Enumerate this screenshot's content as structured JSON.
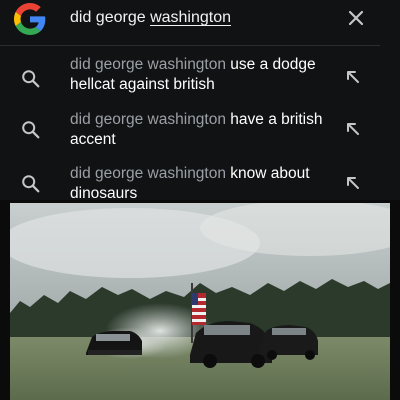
{
  "search": {
    "query_prefix": "did george ",
    "query_underlined": "washington",
    "logo_icon": "google-g-logo",
    "clear_icon": "close-icon"
  },
  "suggestions": [
    {
      "prefix": "did george washington ",
      "completion": "use a dodge hellcat against british",
      "icon": "search-icon",
      "action_icon": "arrow-up-left-icon"
    },
    {
      "prefix": "did george washington ",
      "completion": "have a british accent",
      "icon": "search-icon",
      "action_icon": "arrow-up-left-icon"
    },
    {
      "prefix": "did george washington ",
      "completion": "know about dinosaurs",
      "icon": "search-icon",
      "action_icon": "arrow-up-left-icon"
    }
  ],
  "colors": {
    "panel_bg": "#111213",
    "text_primary": "#ffffff",
    "text_secondary": "#9aa0a6",
    "google_blue": "#4285F4",
    "google_red": "#EA4335",
    "google_yellow": "#FBBC05",
    "google_green": "#34A853"
  },
  "video": {
    "description_icon": "video-still-image"
  }
}
